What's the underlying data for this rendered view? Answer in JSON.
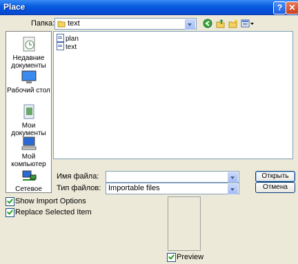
{
  "window": {
    "title": "Place"
  },
  "folder": {
    "label": "Папка:",
    "value": "text"
  },
  "places": [
    {
      "label": "Недавние документы",
      "icon": "recent-documents-icon"
    },
    {
      "label": "Рабочий стол",
      "icon": "desktop-icon"
    },
    {
      "label": "Мои документы",
      "icon": "my-documents-icon"
    },
    {
      "label": "Мой компьютер",
      "icon": "my-computer-icon"
    },
    {
      "label": "Сетевое",
      "icon": "network-icon"
    }
  ],
  "files": [
    {
      "name": "plan"
    },
    {
      "name": "text"
    }
  ],
  "filename": {
    "label": "Имя файла:",
    "value": ""
  },
  "filetype": {
    "label": "Тип файлов:",
    "value": "Importable files"
  },
  "buttons": {
    "open": "Открыть",
    "cancel": "Отмена"
  },
  "options": {
    "show_import": {
      "label": "Show Import Options",
      "checked": true
    },
    "replace_selected": {
      "label": "Replace Selected Item",
      "checked": true
    }
  },
  "preview": {
    "label": "Preview",
    "checked": true
  },
  "colors": {
    "titlebar": "#0a5fe0",
    "dialog": "#ece9d8"
  }
}
